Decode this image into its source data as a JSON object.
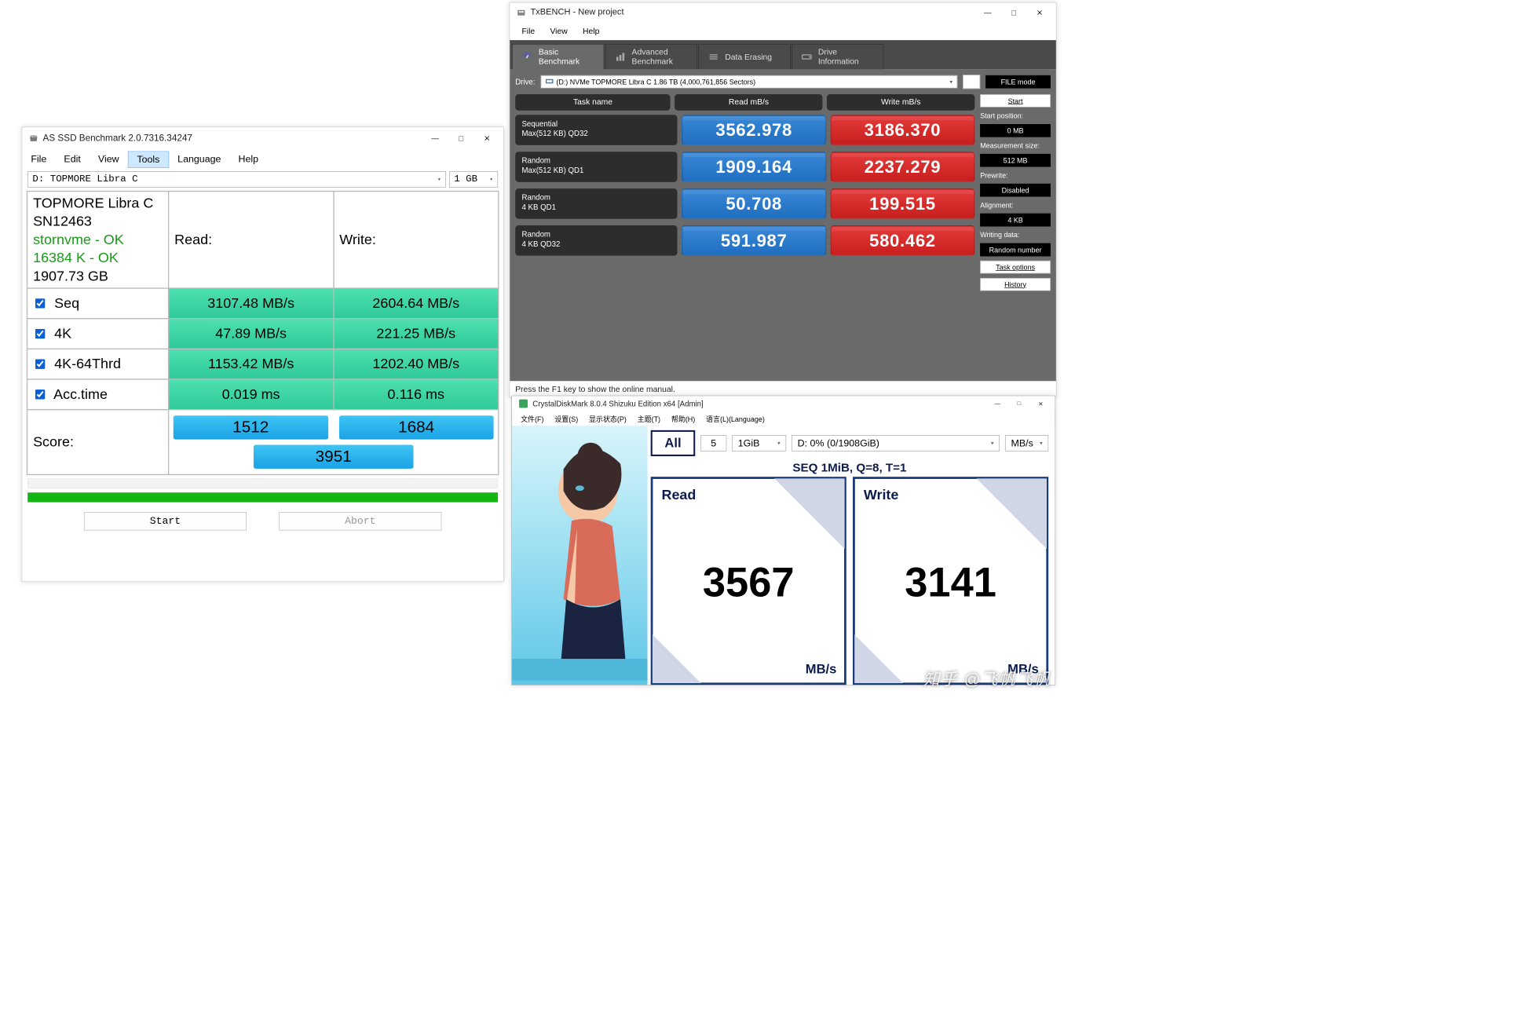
{
  "asssd": {
    "title": "AS SSD Benchmark 2.0.7316.34247",
    "menu": {
      "file": "File",
      "edit": "Edit",
      "view": "View",
      "tools": "Tools",
      "language": "Language",
      "help": "Help"
    },
    "drive": "D: TOPMORE Libra C",
    "size": "1 GB",
    "info": {
      "name": "TOPMORE Libra C",
      "sn": "SN12463",
      "driver": "stornvme - OK",
      "align": "16384 K - OK",
      "capacity": "1907.73 GB"
    },
    "headers": {
      "read": "Read:",
      "write": "Write:"
    },
    "rows": {
      "seq": {
        "label": "Seq",
        "read": "3107.48 MB/s",
        "write": "2604.64 MB/s"
      },
      "fourk": {
        "label": "4K",
        "read": "47.89 MB/s",
        "write": "221.25 MB/s"
      },
      "fourk64": {
        "label": "4K-64Thrd",
        "read": "1153.42 MB/s",
        "write": "1202.40 MB/s"
      },
      "acc": {
        "label": "Acc.time",
        "read": "0.019 ms",
        "write": "0.116 ms"
      }
    },
    "score": {
      "label": "Score:",
      "read": "1512",
      "write": "1684",
      "total": "3951"
    },
    "buttons": {
      "start": "Start",
      "abort": "Abort"
    }
  },
  "txbench": {
    "title": "TxBENCH - New project",
    "menu": {
      "file": "File",
      "view": "View",
      "help": "Help"
    },
    "tabs": {
      "basic": "Basic\nBenchmark",
      "advanced": "Advanced\nBenchmark",
      "erasing": "Data Erasing",
      "drive": "Drive\nInformation"
    },
    "drive_label": "Drive:",
    "drive": "(D:) NVMe TOPMORE Libra C   1.86 TB  (4,000,761,856 Sectors)",
    "filemode": "FILE mode",
    "start": "Start",
    "hdr": {
      "task": "Task name",
      "read": "Read mB/s",
      "write": "Write mB/s"
    },
    "rows": [
      {
        "t1": "Sequential",
        "t2": "Max(512 KB) QD32",
        "read": "3562.978",
        "write": "3186.370"
      },
      {
        "t1": "Random",
        "t2": "Max(512 KB) QD1",
        "read": "1909.164",
        "write": "2237.279"
      },
      {
        "t1": "Random",
        "t2": "4 KB QD1",
        "read": "50.708",
        "write": "199.515"
      },
      {
        "t1": "Random",
        "t2": "4 KB QD32",
        "read": "591.987",
        "write": "580.462"
      }
    ],
    "side": {
      "startpos_label": "Start position:",
      "startpos": "0 MB",
      "measure_label": "Measurement size:",
      "measure": "512 MB",
      "prewrite_label": "Prewrite:",
      "prewrite": "Disabled",
      "align_label": "Alignment:",
      "align": "4 KB",
      "wdata_label": "Writing data:",
      "wdata": "Random number",
      "taskopt": "Task options",
      "history": "History"
    },
    "status": "Press the F1 key to show the online manual."
  },
  "cdm": {
    "title": "CrystalDiskMark 8.0.4 Shizuku Edition x64 [Admin]",
    "menu": {
      "file": "文件(F)",
      "settings": "设置(S)",
      "profile": "显示状态(P)",
      "theme": "主题(T)",
      "help": "帮助(H)",
      "lang": "语言(L)(Language)"
    },
    "all": "All",
    "runs": "5",
    "size": "1GiB",
    "drive": "D: 0% (0/1908GiB)",
    "unit": "MB/s",
    "testlabel": "SEQ 1MiB, Q=8, T=1",
    "read_label": "Read",
    "read_value": "3567",
    "read_unit": "MB/s",
    "write_label": "Write",
    "write_value": "3141",
    "write_unit": "MB/s"
  },
  "watermark": "知乎 @飞帆飞帆",
  "chart_data": [
    {
      "type": "table",
      "title": "AS SSD Benchmark",
      "columns": [
        "Read",
        "Write"
      ],
      "rows": [
        {
          "test": "Seq (MB/s)",
          "Read": 3107.48,
          "Write": 2604.64
        },
        {
          "test": "4K (MB/s)",
          "Read": 47.89,
          "Write": 221.25
        },
        {
          "test": "4K-64Thrd (MB/s)",
          "Read": 1153.42,
          "Write": 1202.4
        },
        {
          "test": "Acc.time (ms)",
          "Read": 0.019,
          "Write": 0.116
        },
        {
          "test": "Score",
          "Read": 1512,
          "Write": 1684
        },
        {
          "test": "Total score",
          "value": 3951
        }
      ]
    },
    {
      "type": "table",
      "title": "TxBENCH Basic Benchmark (MB/s)",
      "columns": [
        "Read",
        "Write"
      ],
      "rows": [
        {
          "test": "Sequential Max(512 KB) QD32",
          "Read": 3562.978,
          "Write": 3186.37
        },
        {
          "test": "Random Max(512 KB) QD1",
          "Read": 1909.164,
          "Write": 2237.279
        },
        {
          "test": "Random 4 KB QD1",
          "Read": 50.708,
          "Write": 199.515
        },
        {
          "test": "Random 4 KB QD32",
          "Read": 591.987,
          "Write": 580.462
        }
      ]
    },
    {
      "type": "table",
      "title": "CrystalDiskMark SEQ 1MiB Q=8 T=1 (MB/s)",
      "columns": [
        "Read",
        "Write"
      ],
      "rows": [
        {
          "Read": 3567,
          "Write": 3141
        }
      ]
    }
  ]
}
